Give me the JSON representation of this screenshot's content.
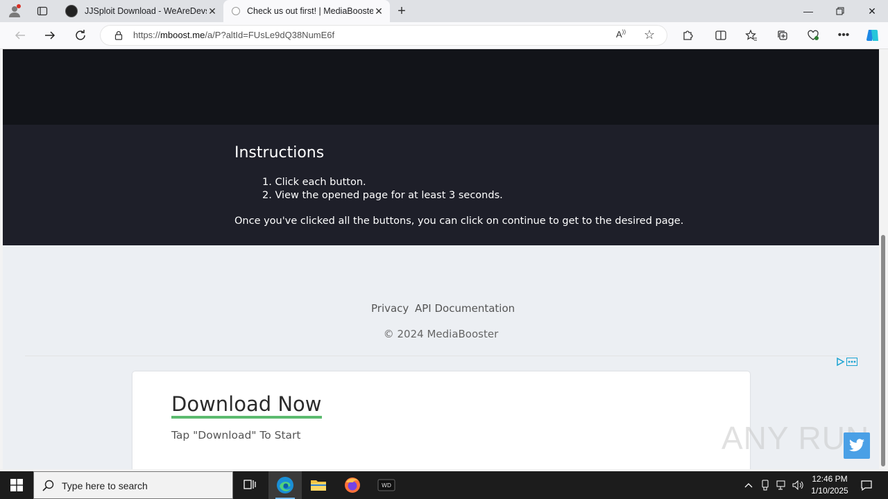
{
  "browser": {
    "tabs": [
      {
        "title": "JJSploit Download - WeAreDevs",
        "active": false
      },
      {
        "title": "Check us out first! | MediaBooster",
        "active": true
      }
    ],
    "url_prefix": "https://",
    "url_host": "mboost.me",
    "url_path": "/a/P?altId=FUsLe9dQ38NumE6f"
  },
  "page": {
    "instructions_title": "Instructions",
    "steps": [
      "1. Click each button.",
      "2. View the opened page for at least 3 seconds."
    ],
    "note": "Once you've clicked all the buttons, you can click on continue to get to the desired page.",
    "footer_links": [
      "Privacy",
      "API Documentation"
    ],
    "copyright": "© 2024 MediaBooster"
  },
  "ad": {
    "title": "Download Now",
    "subtitle": "Tap \"Download\" To Start"
  },
  "watermark": "ANY RUN",
  "taskbar": {
    "search_placeholder": "Type here to search",
    "time": "12:46 PM",
    "date": "1/10/2025"
  },
  "colors": {
    "header_dark": "#121419",
    "instructions_bg": "#1e1f29",
    "ad_underline": "#5cbb6f",
    "twitter_blue": "#4aa0e6"
  }
}
